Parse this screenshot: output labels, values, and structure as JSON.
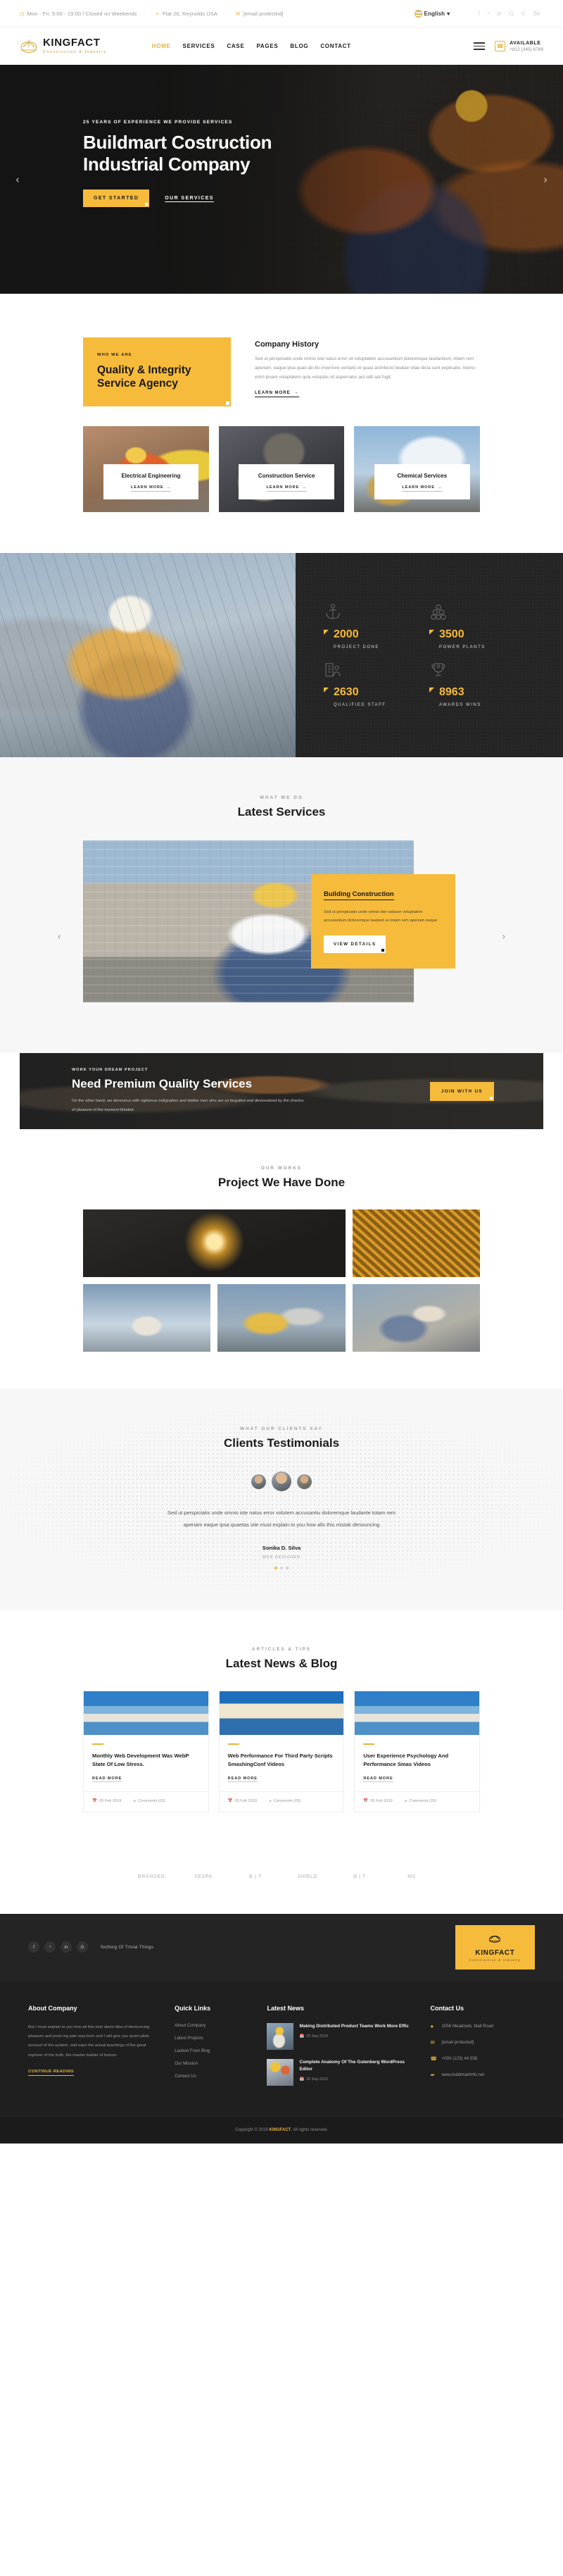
{
  "brand": {
    "name": "KINGFACT",
    "tagline": "Construction & Industry",
    "accent": "#f6bb3b"
  },
  "topbar": {
    "hours": "Mon - Fri: 9:00 - 19:00 / Closed on Weekends",
    "address": "Flat 20, Reynolds USA",
    "email": "[email protected]",
    "language": "English",
    "icons": {
      "clock": "clock-icon",
      "pin": "map-pin-icon",
      "mail": "mail-icon",
      "chevron": "chevron-down-icon"
    },
    "socials": [
      "facebook-icon",
      "twitter-icon",
      "linkedin-icon",
      "google-plus-icon",
      "instagram-icon",
      "behance-icon"
    ],
    "social_glyphs": [
      "f",
      "ᵛ",
      "in",
      "G",
      "©",
      "Bē"
    ]
  },
  "header": {
    "nav": [
      {
        "label": "HOME",
        "active": true
      },
      {
        "label": "SERVICES",
        "active": false
      },
      {
        "label": "CASE",
        "active": false
      },
      {
        "label": "PAGES",
        "active": false
      },
      {
        "label": "BLOG",
        "active": false
      },
      {
        "label": "CONTACT",
        "active": false
      }
    ],
    "available_label": "AVAILABLE",
    "available_phone": "+812 (345) 6789"
  },
  "hero": {
    "kicker": "25 YEARS OF EXPERIENCE WE PROVIDE SERVICES",
    "title_line1": "Buildmart Costruction",
    "title_line2": "Industrial Company",
    "primary_btn": "GET STARTED",
    "secondary_btn": "OUR SERVICES",
    "prev": "‹",
    "next": "›"
  },
  "who": {
    "card_kicker": "WHO WE ARE",
    "card_title_l1": "Quality & Integrity",
    "card_title_l2": "Service Agency",
    "heading": "Company History",
    "paragraph": "Sed ut perspiciatis unde omnis iste natus error sit voluptatem accusantium doloremque laudantium, totam rem aperiam, eaque ipsa quae ab illo inventore veritatis et quasi architecto beatae vitae dicta sunt explicabo. Nemo enim ipsam voluptatem quia voluptas sit aspernatur aut odit aut fugit.",
    "learn_more": "LEARN MORE",
    "arrow": "→"
  },
  "service_cards": [
    {
      "title": "Electrical Engineering",
      "cta": "LEARN MORE"
    },
    {
      "title": "Construction Service",
      "cta": "LEARN MORE"
    },
    {
      "title": "Chemical Services",
      "cta": "LEARN MORE"
    }
  ],
  "stats": [
    {
      "value": "2000",
      "label": "PROJECT DONE",
      "icon": "anchor-icon"
    },
    {
      "value": "3500",
      "label": "POWER PLANTS",
      "icon": "pipes-icon"
    },
    {
      "value": "2630",
      "label": "QUALIFIED STAFF",
      "icon": "staff-building-icon"
    },
    {
      "value": "8963",
      "label": "AWARDS WINS",
      "icon": "trophy-icon"
    }
  ],
  "latest_services": {
    "kicker": "WHAT WE DO",
    "title": "Latest Services",
    "slide": {
      "title": "Building Construction",
      "text": "Sed ut perspiciatis unde omnis iste natuser voluptatem accusantium doloremque laudant us totam rem aperiam eaque",
      "cta": "VIEW DETAILS"
    },
    "prev": "‹",
    "next": "›"
  },
  "cta": {
    "kicker": "WORK YOUR DREAM PROJECT",
    "title": "Need Premium Quality Services",
    "text": "On the other hand, we denounce with righteous indignation and dislike men who are so beguiled and demoralized by the charms of pleasure of the moment blinded",
    "button": "JOIN WITH US"
  },
  "portfolio": {
    "kicker": "OUR WORKS",
    "title": "Project We Have Done"
  },
  "testimonials": {
    "kicker": "WHAT OUR CLIENTS SAY",
    "title": "Clients Testimonials",
    "quote": "Sed ut perspiciatis unde omnis iste natus error volutem accusantiu doloremque laudante totam rem aperiam eaque ipsa quaetas site must explain to you how alls this mistak denouncing",
    "name": "Sonika D. Silva",
    "role": "WEB DESIGNER",
    "dots": 3
  },
  "blog": {
    "kicker": "ARTICLES & TIPS",
    "title": "Latest News & Blog",
    "posts": [
      {
        "title": "Monthly Web Development Was WebP State Of Low Stress.",
        "read_more": "READ MORE",
        "date": "05 Feb 2019",
        "comments": "Comments (03)"
      },
      {
        "title": "Web Performance For Third Party Scripts SmashingConf Videos",
        "read_more": "READ MORE",
        "date": "05 Feb 2019",
        "comments": "Comments (03)"
      },
      {
        "title": "User Experience Psychology And Performance Smas Videos",
        "read_more": "READ MORE",
        "date": "05 Feb 2019",
        "comments": "Comments (03)"
      }
    ]
  },
  "client_logos": [
    "BRANDED",
    "VESPA",
    "B | T",
    "SHIELD",
    "B | T",
    "NG"
  ],
  "footer": {
    "newsletter_text": "Nothing Of Trivial Things",
    "socials": [
      "facebook-icon",
      "twitter-icon",
      "linkedin-icon",
      "google-plus-icon"
    ],
    "social_glyphs": [
      "f",
      "ᵛ",
      "in",
      "G"
    ],
    "about": {
      "heading": "About Company",
      "text": "But I must explain to you how all this mist akem idea of denouncing pleasure and prais ing pain was born and I will give you acom plete account of the system, and expo the actual teachings of the great explorer of the truth, the master builder of human",
      "cta": "CONTINUE READING"
    },
    "quick_links": {
      "heading": "Quick Links",
      "items": [
        "About Company",
        "Latest Projects",
        "Lastest From Blog",
        "Our Mission",
        "Contact Us"
      ]
    },
    "latest_news": {
      "heading": "Latest News",
      "items": [
        {
          "title": "Making Distributed Product Teams Work More Effic",
          "date": "25 Sep 2019"
        },
        {
          "title": "Complete Anatomy Of The Gutenberg WordPress Editor",
          "date": "25 Sep 2019"
        }
      ]
    },
    "contact": {
      "heading": "Contact Us",
      "items": [
        {
          "icon": "map-pin-icon",
          "text": "1056 Meadowb, Mall Road"
        },
        {
          "icon": "mail-icon",
          "text": "[email protected]"
        },
        {
          "icon": "phone-icon",
          "text": "+000 (123) 44 558"
        },
        {
          "icon": "globe-icon",
          "text": "www.buildmartinfo.net"
        }
      ]
    },
    "copyright_pre": "Copyright © 2019 ",
    "copyright_brand": "KINGFACT",
    "copyright_post": ". All rights reserved."
  }
}
